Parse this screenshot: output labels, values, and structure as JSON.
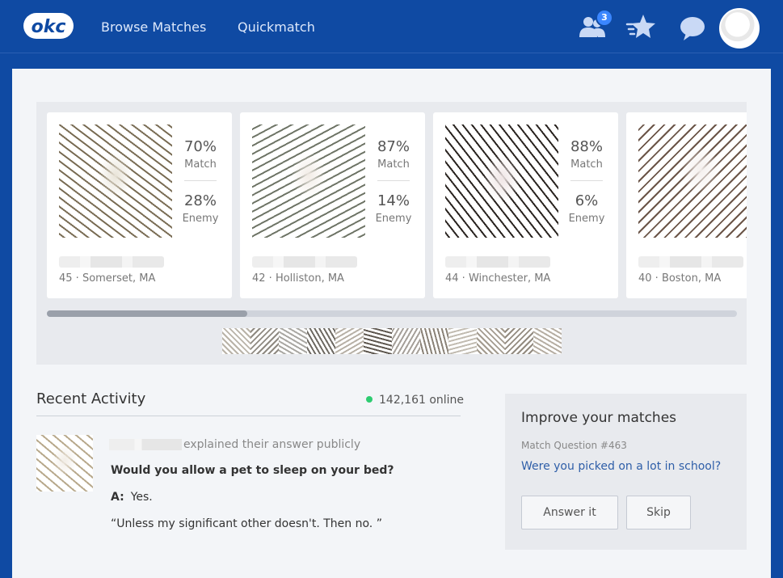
{
  "header": {
    "logo_text": "okc",
    "nav": [
      {
        "label": "Browse Matches"
      },
      {
        "label": "Quickmatch"
      }
    ],
    "friends_badge": "3",
    "icons": [
      "people-icon",
      "star-icon",
      "chat-bubble-icon",
      "avatar"
    ]
  },
  "matches": [
    {
      "match": "70%",
      "match_label": "Match",
      "enemy": "28%",
      "enemy_label": "Enemy",
      "location": "45 · Somerset, MA"
    },
    {
      "match": "87%",
      "match_label": "Match",
      "enemy": "14%",
      "enemy_label": "Enemy",
      "location": "42 · Holliston, MA"
    },
    {
      "match": "88%",
      "match_label": "Match",
      "enemy": "6%",
      "enemy_label": "Enemy",
      "location": "44 · Winchester, MA"
    },
    {
      "location": "40 · Boston, MA"
    }
  ],
  "matches_scroll_position": 0.29,
  "recent_activity": {
    "title": "Recent Activity",
    "online_count": "142,161 online",
    "item": {
      "action": "explained their answer publicly",
      "question": "Would you allow a pet to sleep on your bed?",
      "answer_prefix": "A:",
      "answer": "Yes.",
      "explanation": "“Unless my significant other doesn't. Then no. ”"
    }
  },
  "improve": {
    "title": "Improve your matches",
    "question_label": "Match Question #463",
    "question": "Were you picked on a lot in school?",
    "answer_button": "Answer it",
    "skip_button": "Skip"
  },
  "colors": {
    "header_bg": "#0f4aa3",
    "panel_bg": "#f3f5f8",
    "link": "#2e5ea8",
    "online_dot": "#2ecc71",
    "badge": "#3a86ff"
  }
}
